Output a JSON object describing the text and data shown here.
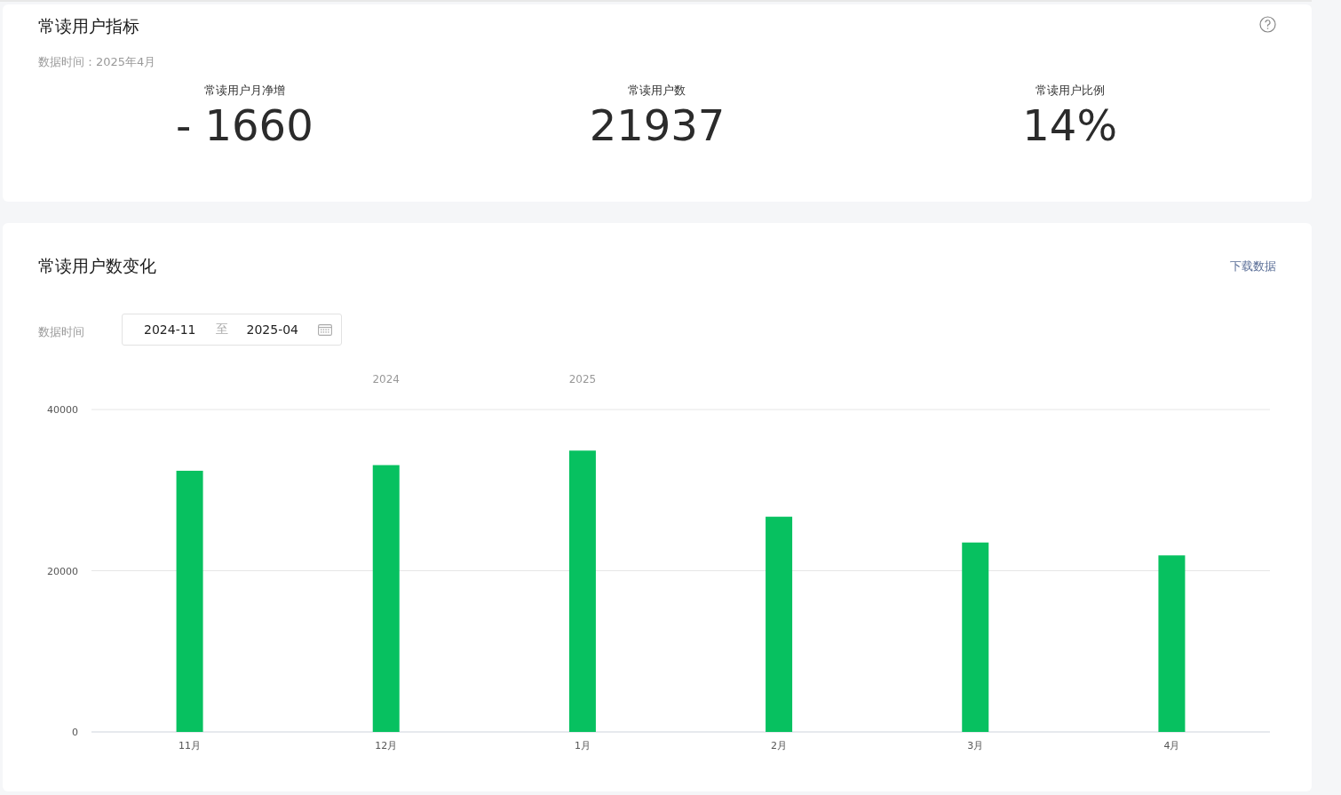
{
  "indicators": {
    "title": "常读用户指标",
    "data_time": "数据时间：2025年4月",
    "metrics": [
      {
        "label": "常读用户月净增",
        "value": "- 1660"
      },
      {
        "label": "常读用户数",
        "value": "21937"
      },
      {
        "label": "常读用户比例",
        "value": "14%"
      }
    ]
  },
  "trend": {
    "title": "常读用户数变化",
    "download_link": "下载数据",
    "date_label": "数据时间",
    "date_start": "2024-11",
    "date_separator": "至",
    "date_end": "2025-04",
    "chart_data": {
      "type": "bar",
      "categories": [
        "11月",
        "12月",
        "1月",
        "2月",
        "3月",
        "4月"
      ],
      "series": [
        {
          "color": "#07c160",
          "values": [
            32400,
            33100,
            34900,
            26700,
            23500,
            21900
          ]
        }
      ],
      "ylim": [
        0,
        40000
      ],
      "yticks": [
        0,
        20000,
        40000
      ],
      "annotations": [
        "2024",
        "2025"
      ]
    }
  }
}
